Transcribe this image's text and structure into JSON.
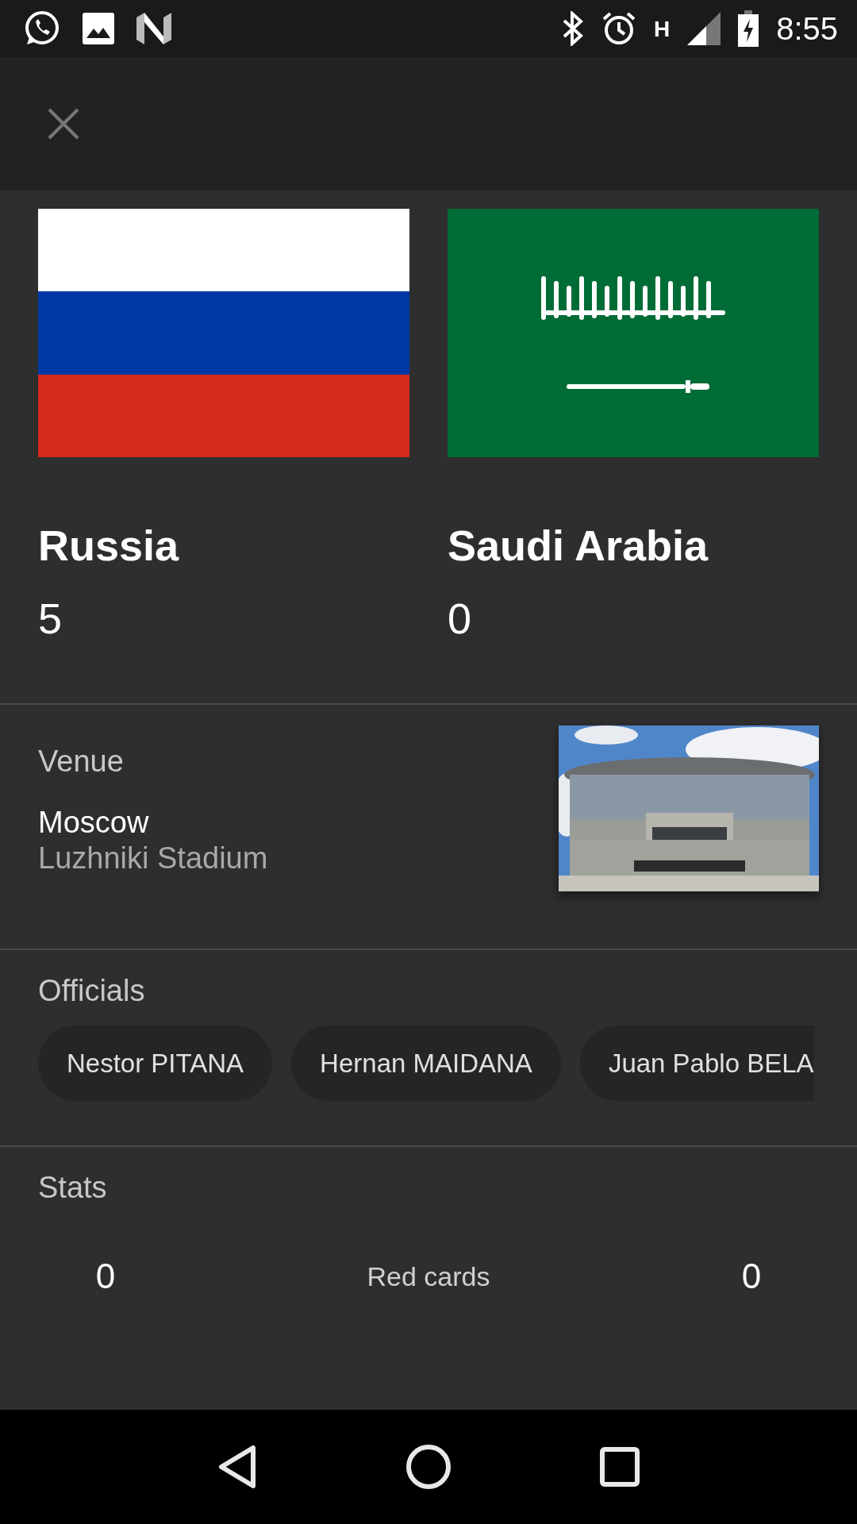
{
  "status_bar": {
    "network": "H",
    "time": "8:55"
  },
  "teams": [
    {
      "name": "Russia",
      "score": "5",
      "kind": "russia"
    },
    {
      "name": "Saudi Arabia",
      "score": "0",
      "kind": "saudi"
    }
  ],
  "venue": {
    "label": "Venue",
    "city": "Moscow",
    "stadium": "Luzhniki Stadium"
  },
  "officials": {
    "label": "Officials",
    "names": [
      "Nestor PITANA",
      "Hernan MAIDANA",
      "Juan Pablo BELA"
    ]
  },
  "stats": {
    "label": "Stats",
    "rows": [
      {
        "home": "0",
        "label": "Red cards",
        "away": "0"
      }
    ]
  }
}
